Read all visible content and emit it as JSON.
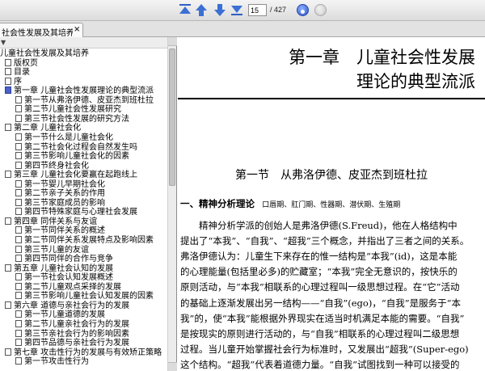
{
  "toolbar": {
    "page_current": "15",
    "page_total": "/ 427",
    "icons": [
      "first-page-icon",
      "prev-page-icon",
      "next-page-icon",
      "last-page-icon",
      "goto-icon",
      "back-icon"
    ]
  },
  "tab": {
    "label": "社会性发展及其培养)",
    "close": "×"
  },
  "toc": {
    "collapse_arrow": "▼",
    "items": [
      "儿童社会性发展及其培养",
      "版权页",
      "目录",
      "序",
      "第一章 儿童社会性发展理论的典型流派",
      "第一节从弗洛伊德、皮亚杰到班杜拉",
      "第二节儿童社会性发展研究",
      "第三节社会性发展的研究方法",
      "第二章 儿童社会化",
      "第一节什么是儿童社会化",
      "第二节社会化过程会自然发生吗",
      "第三节影响儿童社会化的因素",
      "第四节终身社会化",
      "第三章 儿童社会化要赢在起跑线上",
      "第一节婴儿早期社会化",
      "第二节亲子关系的作用",
      "第三节家庭成员的影响",
      "第四节特殊家庭与心理社会发展",
      "第四章 同伴关系与友谊",
      "第一节同伴关系的概述",
      "第二节同伴关系发展特点及影响因素",
      "第三节儿童的友谊",
      "第四节同伴的合作与竞争",
      "第五章 儿童社会认知的发展",
      "第一节社会认知发展概述",
      "第二节儿童观点采择的发展",
      "第三节影响儿童社会认知发展的因素",
      "第六章 道德与亲社会行为的发展",
      "第一节儿童道德的发展",
      "第二节儿童亲社会行为的发展",
      "第三节亲社会行为的影响因素",
      "第四节品德与亲社会行为发展",
      "第七章 攻击性行为的发展与有效矫正策略",
      "第一节攻击性行为"
    ]
  },
  "document": {
    "chapter_title_line1": "第一章　儿童社会性发展",
    "chapter_title_line2": "理论的典型流派",
    "section_title": "第一节　从弗洛伊德、皮亚杰到班杜拉",
    "subheading_main": "一、精神分析理论",
    "subheading_sub": "口唇期、肛门期、性器期、潜伏期、生殖期",
    "body_lines": [
      "　　精神分析学派的创始人是弗洛伊德(S.Freud)，他在人格结构中",
      "提出了“本我”、“自我”、“超我”三个概念，并指出了三者之间的关系。",
      "弗洛伊德认为：儿童生下来存在的惟一结构是“本我”(id)，这是本能",
      "的心理能量(包括里必多)的贮藏室；“本我”完全无意识的，按快乐的",
      "原则活动，与“本我”相联系的心理过程叫一级思想过程。在“它”活动",
      "的基础上逐渐发展出另一结构——“自我”(ego)，“自我”是服务于“本",
      "我”的，使“本我”能根据外界现实在适当时机满足本能的需要。“自我”",
      "是按现实的原则进行活动的，与“自我”相联系的心理过程叫二级思想",
      "过程。当儿童开始掌握社会行为标准时，又发展出“超我”(Super-ego)",
      "这个结构。“超我”代表着道德力量。“自我”试图找到一种可以接受的"
    ]
  }
}
